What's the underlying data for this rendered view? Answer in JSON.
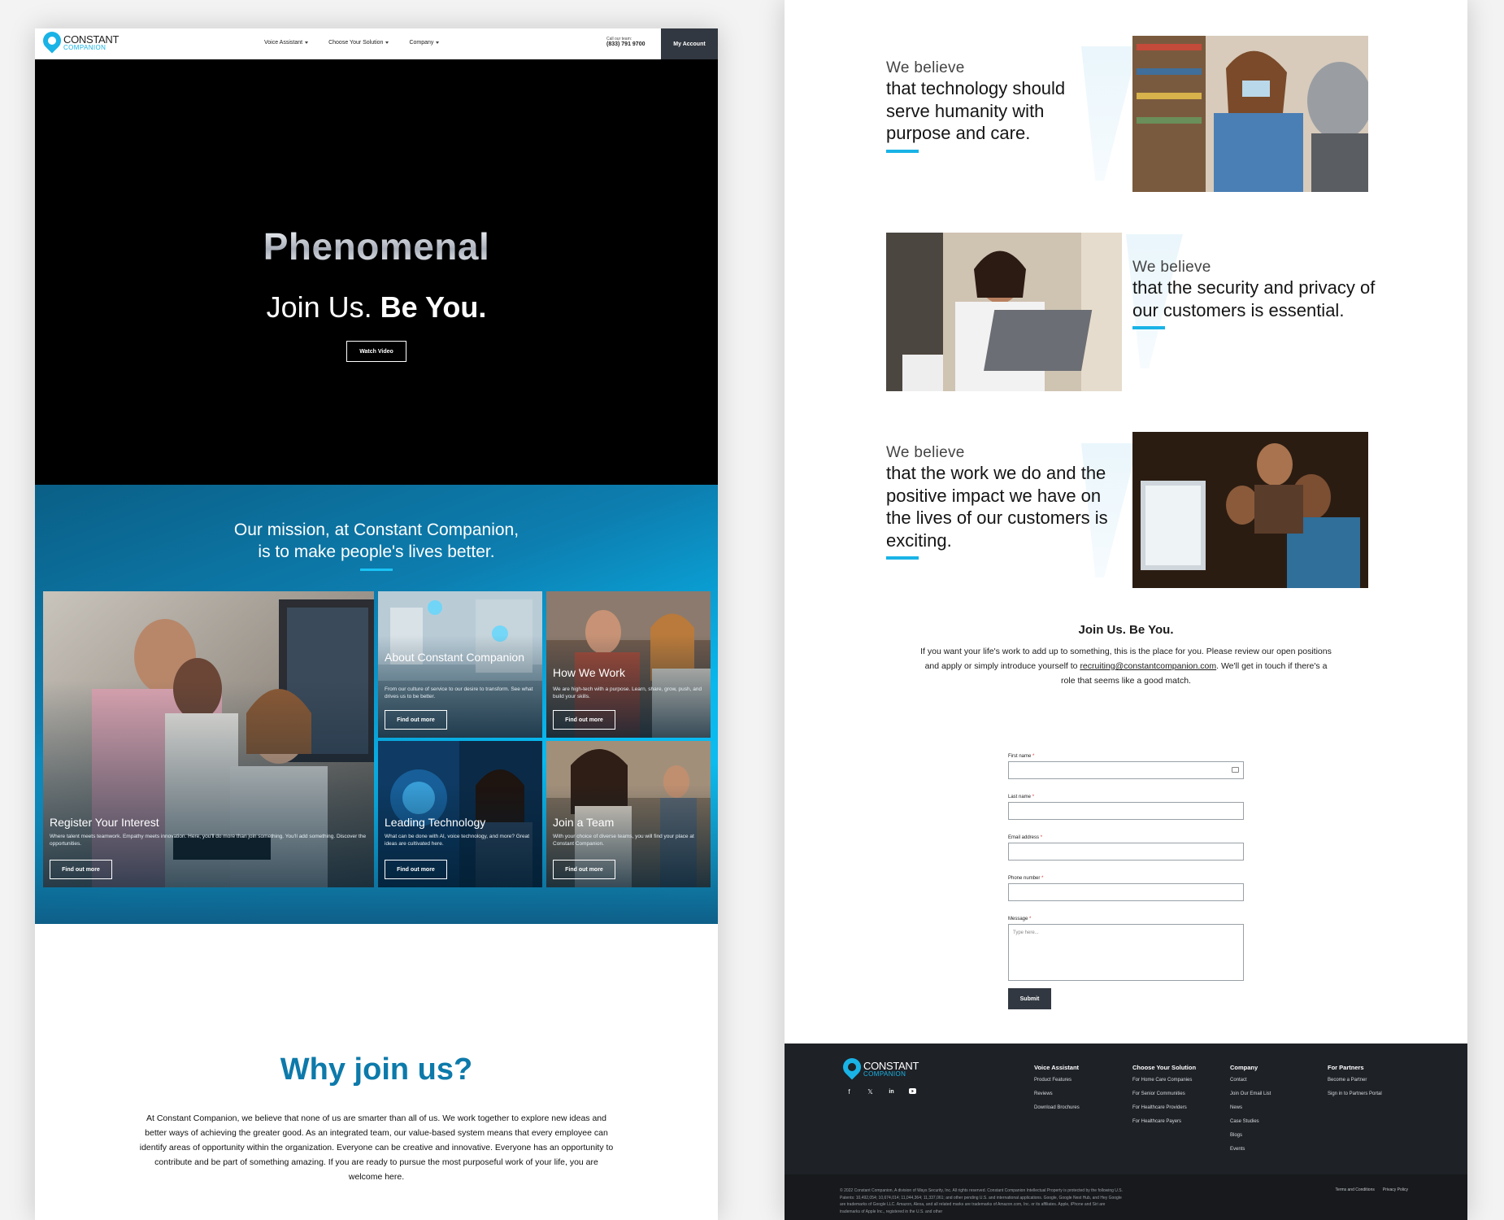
{
  "left": {
    "nav": {
      "logo_top": "CONSTANT",
      "logo_bottom": "COMPANION",
      "menu": [
        "Voice Assistant",
        "Choose Your Solution",
        "Company"
      ],
      "call_label": "Call our team:",
      "call_number": "(833) 791 9700",
      "account_label": "My Account"
    },
    "hero": {
      "title": "Phenomenal",
      "subtitle_regular": "Join Us.",
      "subtitle_bold": "Be You.",
      "button": "Watch Video"
    },
    "mission": {
      "line1": "Our mission, at Constant Companion,",
      "line2": "is to make people's lives better."
    },
    "tiles": [
      {
        "title": "Register Your Interest",
        "desc": "Where talent meets teamwork. Empathy meets innovation. Here, you'll do more than join something. You'll add something. Discover the opportunities.",
        "button": "Find out more"
      },
      {
        "title": "About Constant Companion",
        "desc": "From our culture of service to our desire to transform. See what drives us to be better.",
        "button": "Find out more"
      },
      {
        "title": "How We Work",
        "desc": "We are high-tech with a purpose. Learn, share, grow, push, and build your skills.",
        "button": "Find out more"
      },
      {
        "title": "Leading Technology",
        "desc": "What can be done with AI, voice technology, and more? Great ideas are cultivated here.",
        "button": "Find out more"
      },
      {
        "title": "Join a Team",
        "desc": "With your choice of diverse teams, you will find your place at Constant Companion.",
        "button": "Find out more"
      }
    ],
    "why": {
      "title": "Why join us?",
      "body": "At Constant Companion, we believe that none of us are smarter than all of us. We work together to explore new ideas and better ways of achieving the greater good. As an integrated team, our value-based system means that every employee can identify areas of opportunity within the organization. Everyone can be creative and innovative. Everyone has an opportunity to contribute and be part of something amazing. If you are ready to pursue the most purposeful work of your life, you are welcome here."
    }
  },
  "right": {
    "beliefs": [
      {
        "pre": "We believe",
        "text": "that technology should serve humanity with purpose and care."
      },
      {
        "pre": "We believe",
        "text": "that the security and privacy of our customers is essential."
      },
      {
        "pre": "We believe",
        "text": "that the work we do and the positive impact we have on the lives of our customers is exciting."
      }
    ],
    "join": {
      "title": "Join Us. Be You.",
      "body_before": "If you want your life's work to add up to something, this is the place for you. Please review our open positions and apply or simply introduce yourself to",
      "email": "recruiting@constantcompanion.com",
      "body_after": ". We'll get in touch if there's a role that seems like a good match."
    },
    "form": {
      "first_name": "First name",
      "last_name": "Last name",
      "email": "Email address",
      "phone": "Phone number",
      "message": "Message",
      "message_placeholder": "Type here...",
      "required_mark": "*",
      "submit": "Submit"
    },
    "footer": {
      "logo_top": "CONSTANT",
      "logo_bottom": "COMPANION",
      "socials": [
        "f",
        "t",
        "in",
        "yt"
      ],
      "columns": [
        {
          "heading": "Voice Assistant",
          "links": [
            "Product Features",
            "Reviews",
            "Download Brochures"
          ]
        },
        {
          "heading": "Choose Your Solution",
          "links": [
            "For Home Care Companies",
            "For Senior Communities",
            "For Healthcare Providers",
            "For Healthcare Payers"
          ]
        },
        {
          "heading": "Company",
          "links": [
            "Contact",
            "Join Our Email List",
            "News",
            "Case Studies",
            "Blogs",
            "Events"
          ]
        },
        {
          "heading": "For Partners",
          "links": [
            "Become a Partner",
            "Sign in to Partners Portal"
          ]
        }
      ],
      "copyright": "© 2022 Constant Companion, A division of Ways Security, Inc. All rights reserved. Constant Companion Intellectual Property is protected by the following U.S. Patents: 10,492,054; 10,674,014; 11,044,364; 11,337,061; and other pending U.S. and international applications. Google, Google Nest Hub, and Hey Google are trademarks of Google LLC. Amazon, Alexa, and all related marks are trademarks of Amazon.com, Inc. or its affiliates. Apple, iPhone and Siri are trademarks of Apple Inc., registered in the U.S. and other",
      "legal": [
        "Terms and Conditions",
        "Privacy Policy"
      ]
    }
  }
}
